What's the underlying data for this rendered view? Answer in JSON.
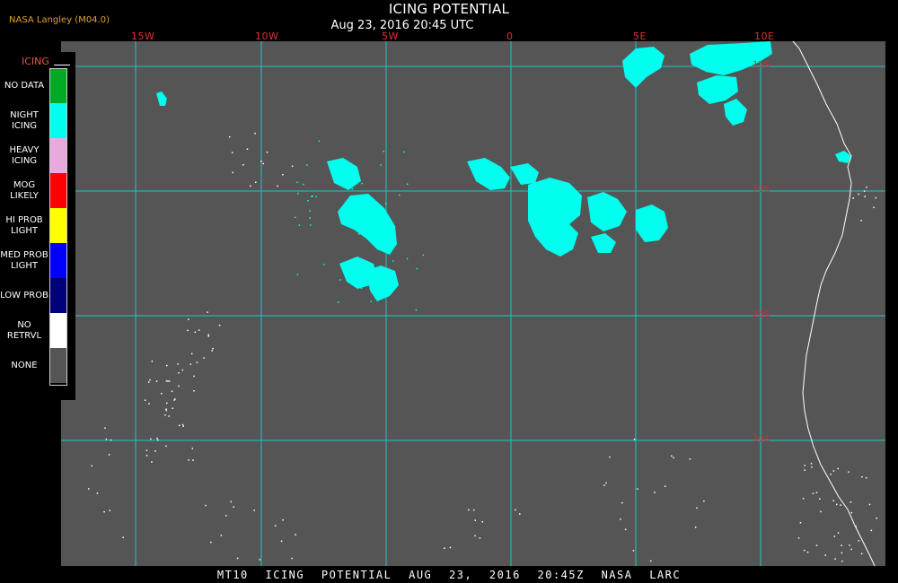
{
  "header": {
    "source": "NASA Langley (M04.0)",
    "title": "ICING POTENTIAL",
    "datetime": "Aug 23, 2016 20:45 UTC"
  },
  "longitude_labels": [
    "15W",
    "10W",
    "5W",
    "0",
    "5E",
    "10E"
  ],
  "latitude_labels": [
    "15S",
    "20S",
    "25S",
    "30S"
  ],
  "legend": {
    "title": "ICING",
    "items": [
      {
        "label": "NO DATA",
        "color": "#00aa22"
      },
      {
        "label": "NIGHT ICING",
        "color": "#00ffee"
      },
      {
        "label": "HEAVY ICING",
        "color": "#e8aadd"
      },
      {
        "label": "MOG LIKELY",
        "color": "#ff0000"
      },
      {
        "label": "HI PROB LIGHT",
        "color": "#ffff00"
      },
      {
        "label": "MED PROB LIGHT",
        "color": "#0000ff"
      },
      {
        "label": "LOW PROB",
        "color": "#00007a"
      },
      {
        "label": "NO RETRVL",
        "color": "#ffffff"
      },
      {
        "label": "NONE",
        "color": "#555555"
      }
    ]
  },
  "colors": {
    "background": "#555555",
    "grid": "#19c6c6",
    "icing": "#00ffee",
    "coastline": "#ffffff",
    "grid_label": "#cc3333"
  },
  "footer": {
    "text": "MT10 ICING POTENTIAL AUG 23, 2016 20:45Z NASA LARC"
  }
}
